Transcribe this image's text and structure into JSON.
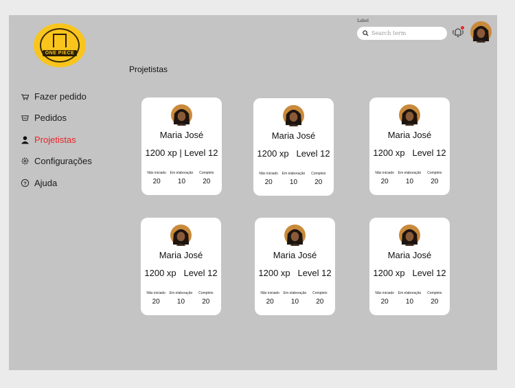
{
  "logo": {
    "text": "ONE PIECE"
  },
  "search": {
    "label": "Label",
    "placeholder": "Search term"
  },
  "notifications": {
    "has_unread": true
  },
  "sidebar": {
    "items": [
      {
        "label": "Fazer pedido",
        "icon": "basket-icon",
        "active": false
      },
      {
        "label": "Pedidos",
        "icon": "bowl-icon",
        "active": false
      },
      {
        "label": "Projetistas",
        "icon": "user-icon",
        "active": true
      },
      {
        "label": "Configurações",
        "icon": "gear-icon",
        "active": false
      },
      {
        "label": "Ajuda",
        "icon": "help-icon",
        "active": false
      }
    ]
  },
  "page": {
    "title": "Projetistas"
  },
  "colors": {
    "accent": "#e8262a",
    "logo_yellow": "#f9c51d",
    "panel": "#c4c4c4",
    "card": "#ffffff"
  },
  "stat_labels": [
    "Não iniciado",
    "Em elaboração",
    "Completo"
  ],
  "cards": [
    {
      "name": "Maria José",
      "xp_line": "1200 xp | Level 12",
      "stats": [
        "20",
        "10",
        "20"
      ]
    },
    {
      "name": "Maria José",
      "xp_line": "1200 xp   Level 12",
      "stats": [
        "20",
        "10",
        "20"
      ]
    },
    {
      "name": "Maria José",
      "xp_line": "1200 xp   Level 12",
      "stats": [
        "20",
        "10",
        "20"
      ]
    },
    {
      "name": "Maria José",
      "xp_line": "1200 xp   Level 12",
      "stats": [
        "20",
        "10",
        "20"
      ]
    },
    {
      "name": "Maria José",
      "xp_line": "1200 xp   Level 12",
      "stats": [
        "20",
        "10",
        "20"
      ]
    },
    {
      "name": "Maria José",
      "xp_line": "1200 xp   Level 12",
      "stats": [
        "20",
        "10",
        "20"
      ]
    }
  ]
}
